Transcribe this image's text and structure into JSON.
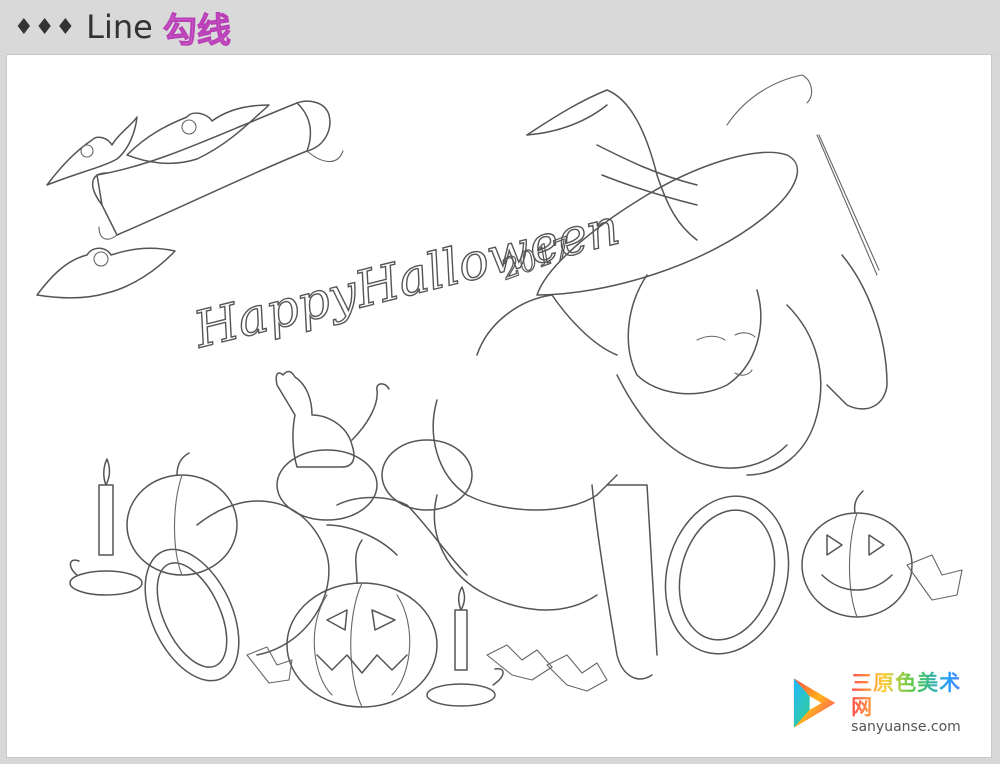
{
  "header": {
    "diamonds": "♦♦♦",
    "title_en": "Line",
    "title_cn": "勾线"
  },
  "artwork": {
    "lettering": "HappyHalloween",
    "year": "2017"
  },
  "watermark": {
    "site_cn": "三原色美术网",
    "site_en": "sanyuanse.com"
  },
  "colors": {
    "header_bg": "#d9d9d9",
    "title_cn": "#d76ad3",
    "line": "#555555",
    "canvas": "#ffffff"
  }
}
